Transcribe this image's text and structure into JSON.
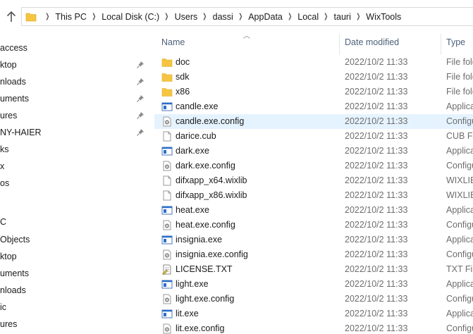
{
  "breadcrumb": [
    "This PC",
    "Local Disk (C:)",
    "Users",
    "dassi",
    "AppData",
    "Local",
    "tauri",
    "WixTools"
  ],
  "nav": [
    {
      "label": "access",
      "pinned": false
    },
    {
      "label": "ktop",
      "pinned": true
    },
    {
      "label": "nloads",
      "pinned": true
    },
    {
      "label": "uments",
      "pinned": true
    },
    {
      "label": "ures",
      "pinned": true
    },
    {
      "label": "NY-HAIER",
      "pinned": true
    },
    {
      "label": "ks",
      "pinned": false
    },
    {
      "label": "x",
      "pinned": false
    },
    {
      "label": "os",
      "pinned": false
    },
    {
      "label": "",
      "pinned": false
    },
    {
      "label": "C",
      "pinned": false
    },
    {
      "label": "Objects",
      "pinned": false
    },
    {
      "label": "ktop",
      "pinned": false
    },
    {
      "label": "uments",
      "pinned": false
    },
    {
      "label": "nloads",
      "pinned": false
    },
    {
      "label": "ic",
      "pinned": false
    },
    {
      "label": "ures",
      "pinned": false
    }
  ],
  "columns": {
    "name": "Name",
    "date": "Date modified",
    "type": "Type"
  },
  "files": [
    {
      "name": "doc",
      "date": "2022/10/2 11:33",
      "type": "File fold",
      "icon": "folder"
    },
    {
      "name": "sdk",
      "date": "2022/10/2 11:33",
      "type": "File fold",
      "icon": "folder"
    },
    {
      "name": "x86",
      "date": "2022/10/2 11:33",
      "type": "File fold",
      "icon": "folder"
    },
    {
      "name": "candle.exe",
      "date": "2022/10/2 11:33",
      "type": "Applica",
      "icon": "exe"
    },
    {
      "name": "candle.exe.config",
      "date": "2022/10/2 11:33",
      "type": "Configu",
      "icon": "config"
    },
    {
      "name": "darice.cub",
      "date": "2022/10/2 11:33",
      "type": "CUB File",
      "icon": "file"
    },
    {
      "name": "dark.exe",
      "date": "2022/10/2 11:33",
      "type": "Applica",
      "icon": "exe"
    },
    {
      "name": "dark.exe.config",
      "date": "2022/10/2 11:33",
      "type": "Configu",
      "icon": "config"
    },
    {
      "name": "difxapp_x64.wixlib",
      "date": "2022/10/2 11:33",
      "type": "WIXLIB",
      "icon": "file"
    },
    {
      "name": "difxapp_x86.wixlib",
      "date": "2022/10/2 11:33",
      "type": "WIXLIB",
      "icon": "file"
    },
    {
      "name": "heat.exe",
      "date": "2022/10/2 11:33",
      "type": "Applica",
      "icon": "exe"
    },
    {
      "name": "heat.exe.config",
      "date": "2022/10/2 11:33",
      "type": "Configu",
      "icon": "config"
    },
    {
      "name": "insignia.exe",
      "date": "2022/10/2 11:33",
      "type": "Applica",
      "icon": "exe"
    },
    {
      "name": "insignia.exe.config",
      "date": "2022/10/2 11:33",
      "type": "Configu",
      "icon": "config"
    },
    {
      "name": "LICENSE.TXT",
      "date": "2022/10/2 11:33",
      "type": "TXT File",
      "icon": "txt"
    },
    {
      "name": "light.exe",
      "date": "2022/10/2 11:33",
      "type": "Applica",
      "icon": "exe"
    },
    {
      "name": "light.exe.config",
      "date": "2022/10/2 11:33",
      "type": "Configu",
      "icon": "config"
    },
    {
      "name": "lit.exe",
      "date": "2022/10/2 11:33",
      "type": "Applica",
      "icon": "exe"
    },
    {
      "name": "lit.exe.config",
      "date": "2022/10/2 11:33",
      "type": "Configu",
      "icon": "config"
    }
  ],
  "selected_file": "candle.exe.config",
  "colors": {
    "selection": "#e5f3ff",
    "folder": "#f5c542",
    "exe_blue": "#2a6fc9",
    "header_text": "#4c607a"
  }
}
